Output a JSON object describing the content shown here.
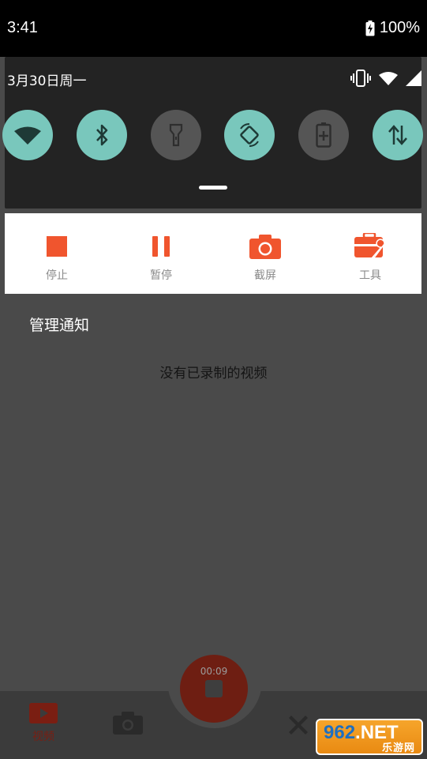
{
  "status_bar": {
    "time": "3:41",
    "battery_percent": "100%"
  },
  "quick_settings": {
    "date": "3月30日周一",
    "tiles": [
      {
        "name": "wifi-icon",
        "state": "on"
      },
      {
        "name": "bluetooth-icon",
        "state": "on"
      },
      {
        "name": "flashlight-icon",
        "state": "off"
      },
      {
        "name": "auto-rotate-icon",
        "state": "on"
      },
      {
        "name": "battery-saver-icon",
        "state": "off"
      },
      {
        "name": "mobile-data-icon",
        "state": "on"
      }
    ]
  },
  "notification": {
    "accent_color": "#f0552e",
    "actions": [
      {
        "icon": "stop-icon",
        "label": "停止"
      },
      {
        "icon": "pause-icon",
        "label": "暂停"
      },
      {
        "icon": "camera-icon",
        "label": "截屏"
      },
      {
        "icon": "toolbox-icon",
        "label": "工具"
      }
    ]
  },
  "manage_label": "管理通知",
  "app": {
    "empty_message": "没有已录制的视频",
    "record_timer": "00:09",
    "nav": {
      "video_label": "视频"
    }
  },
  "watermark": {
    "brand_num": "962",
    "brand_net": ".NET",
    "brand_cn": "乐游网"
  }
}
